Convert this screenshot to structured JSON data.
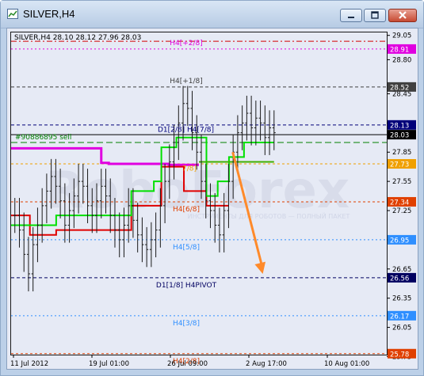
{
  "window": {
    "title": "SILVER,H4"
  },
  "chart_data": {
    "type": "line",
    "symbol": "SILVER,H4",
    "ohlc": {
      "open": 28.1,
      "high": 28.12,
      "low": 27.96,
      "close": 28.03
    },
    "header_text": "SILVER,H4  28.10 28.12 27.96 28.03",
    "ylim": [
      25.77,
      29.08
    ],
    "y_ticks": [
      {
        "v": 29.05,
        "t": "29.05"
      },
      {
        "v": 28.8,
        "t": "28.80"
      },
      {
        "v": 28.45,
        "t": "28.45"
      },
      {
        "v": 28.15,
        "t": "28.15"
      },
      {
        "v": 27.85,
        "t": "27.85"
      },
      {
        "v": 27.55,
        "t": "27.55"
      },
      {
        "v": 27.25,
        "t": "27.25"
      },
      {
        "v": 26.95,
        "t": "26.95"
      },
      {
        "v": 26.65,
        "t": "26.65"
      },
      {
        "v": 26.35,
        "t": "26.35"
      },
      {
        "v": 26.05,
        "t": "26.05"
      },
      {
        "v": 25.75,
        "t": "25.75"
      }
    ],
    "x_labels": [
      "11 Jul 2012",
      "19 Jul 01:00",
      "26 Jul 09:00",
      "2 Aug 17:00",
      "10 Aug 01:00"
    ],
    "levels": [
      {
        "value": 28.99,
        "label": "",
        "tag": "",
        "color": "#d40000",
        "dash": "7,3,2,3"
      },
      {
        "value": 28.91,
        "label": "H4[+2/8]",
        "tag": "28.91",
        "color": "#e000e0",
        "dash": "2,3"
      },
      {
        "value": 28.52,
        "label": "H4[+1/8]",
        "tag": "28.52",
        "color": "#404040",
        "dash": "4,3"
      },
      {
        "value": 28.13,
        "label": "",
        "tag": "28.13",
        "color": "#00007a",
        "dash": "4,3"
      },
      {
        "value": 28.03,
        "label": "",
        "tag": "28.03",
        "color": "#000000",
        "dash": ""
      },
      {
        "value": 27.95,
        "label": "#90886895 sell",
        "tag": "",
        "color": "#008000",
        "dash": "8,4"
      },
      {
        "value": 27.73,
        "label": "",
        "tag": "27.73",
        "color": "#f0a000",
        "dash": "3,3"
      },
      {
        "value": 27.34,
        "label": "H4[6/8]",
        "tag": "27.34",
        "color": "#e04000",
        "dash": "3,3"
      },
      {
        "value": 26.95,
        "label": "H4[5/8]",
        "tag": "26.95",
        "color": "#2f8fff",
        "dash": "2,3"
      },
      {
        "value": 26.56,
        "label": "D1[1/8] H4PIVOT",
        "tag": "26.56",
        "color": "#000060",
        "dash": "4,3"
      },
      {
        "value": 26.17,
        "label": "H4[3/8]",
        "tag": "26.17",
        "color": "#2f8fff",
        "dash": "2,3"
      },
      {
        "value": 25.78,
        "label": "H4[2/8]",
        "tag": "25.78",
        "color": "#e04000",
        "dash": "3,3"
      }
    ],
    "extra_labels": [
      {
        "text": "D1[2/8] H4[7/8]",
        "value": 28.06
      },
      {
        "text": "7/8]",
        "value": 27.66
      }
    ],
    "watermark": "RoboForex",
    "watermark_sub": "ИНСТРУМЕНТЫ ДЛЯ РОБОТОВ — ПОЛНЫЙ ПАКЕТ",
    "prices": [
      27.2,
      27.05,
      26.8,
      26.6,
      26.9,
      27.1,
      27.3,
      27.45,
      27.6,
      27.5,
      27.35,
      27.1,
      27.25,
      27.4,
      27.55,
      27.5,
      27.3,
      27.2,
      27.35,
      27.5,
      27.4,
      27.2,
      27.05,
      26.95,
      27.1,
      27.3,
      27.15,
      27.0,
      26.9,
      26.85,
      26.95,
      27.05,
      27.3,
      27.55,
      27.75,
      27.95,
      28.15,
      28.35,
      28.3,
      28.05,
      27.85,
      27.55,
      27.35,
      27.25,
      27.1,
      27.0,
      27.25,
      27.55,
      27.85,
      28.05,
      28.15,
      28.25,
      28.1,
      28.2,
      28.15,
      28.0,
      28.1,
      28.05
    ],
    "green_stair": [
      {
        "from": 0.0,
        "to": 0.12,
        "v": 27.1
      },
      {
        "from": 0.12,
        "to": 0.32,
        "v": 27.2
      },
      {
        "from": 0.32,
        "to": 0.38,
        "v": 27.45
      },
      {
        "from": 0.38,
        "to": 0.4,
        "v": 27.55
      },
      {
        "from": 0.4,
        "to": 0.44,
        "v": 27.9
      },
      {
        "from": 0.44,
        "to": 0.52,
        "v": 28.0
      },
      {
        "from": 0.52,
        "to": 0.55,
        "v": 27.4
      },
      {
        "from": 0.55,
        "to": 0.58,
        "v": 27.55
      },
      {
        "from": 0.58,
        "to": 0.62,
        "v": 27.8
      },
      {
        "from": 0.62,
        "to": 0.66,
        "v": 27.95
      },
      {
        "from": 0.66,
        "to": 0.7,
        "v": 27.95
      }
    ],
    "red_stair": [
      {
        "from": 0.0,
        "to": 0.05,
        "v": 27.2
      },
      {
        "from": 0.05,
        "to": 0.12,
        "v": 27.0
      },
      {
        "from": 0.12,
        "to": 0.32,
        "v": 27.05
      },
      {
        "from": 0.32,
        "to": 0.4,
        "v": 27.3
      },
      {
        "from": 0.4,
        "to": 0.46,
        "v": 27.7
      },
      {
        "from": 0.46,
        "to": 0.52,
        "v": 27.45
      },
      {
        "from": 0.52,
        "to": 0.58,
        "v": 27.3
      }
    ],
    "magenta_line": [
      {
        "from": 0.0,
        "to": 0.24,
        "v": 27.89
      },
      {
        "from": 0.24,
        "to": 0.26,
        "v": 27.74
      },
      {
        "from": 0.26,
        "to": 0.42,
        "v": 27.73
      },
      {
        "from": 0.42,
        "to": 0.5,
        "v": 27.72
      }
    ],
    "green_flat": {
      "from": 0.5,
      "to": 0.7,
      "v": 27.75
    },
    "arrow": {
      "from_value": 27.85,
      "to_value": 26.6
    }
  }
}
